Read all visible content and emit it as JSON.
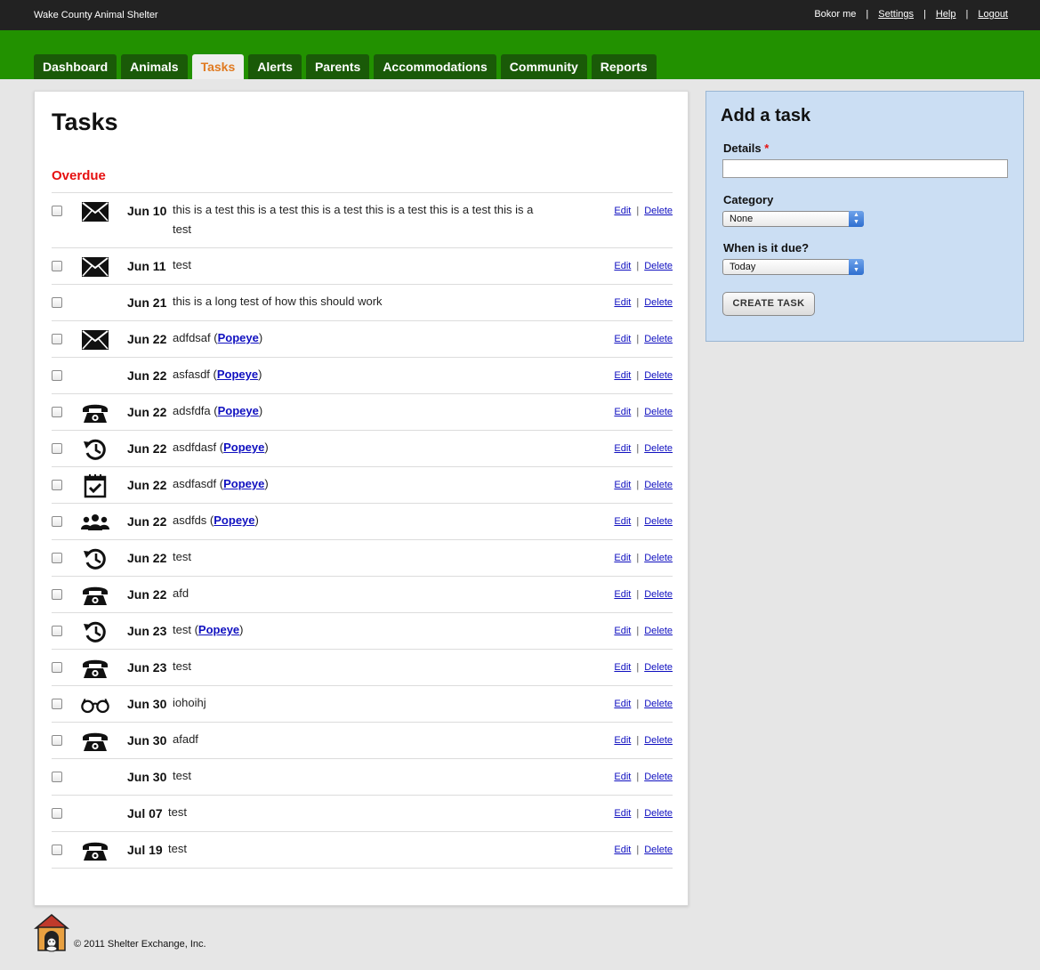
{
  "topbar": {
    "org": "Wake County Animal Shelter",
    "user": "Bokor me",
    "settings": "Settings",
    "help": "Help",
    "logout": "Logout",
    "separator": "|"
  },
  "nav": {
    "tabs": [
      {
        "label": "Dashboard",
        "active": false
      },
      {
        "label": "Animals",
        "active": false
      },
      {
        "label": "Tasks",
        "active": true
      },
      {
        "label": "Alerts",
        "active": false
      },
      {
        "label": "Parents",
        "active": false
      },
      {
        "label": "Accommodations",
        "active": false
      },
      {
        "label": "Community",
        "active": false
      },
      {
        "label": "Reports",
        "active": false
      }
    ]
  },
  "main": {
    "title": "Tasks",
    "section": "Overdue",
    "edit_label": "Edit",
    "delete_label": "Delete",
    "separator": "|",
    "tasks": [
      {
        "icon": "mail-icon",
        "date": "Jun 10",
        "desc": "this is a test this is a test this is a test this is a test this is a test this is a test",
        "link": ""
      },
      {
        "icon": "mail-icon",
        "date": "Jun 11",
        "desc": "test",
        "link": ""
      },
      {
        "icon": "",
        "date": "Jun 21",
        "desc": "this is a long test of how this should work",
        "link": ""
      },
      {
        "icon": "mail-icon",
        "date": "Jun 22",
        "desc": "adfdsaf",
        "link": "Popeye"
      },
      {
        "icon": "",
        "date": "Jun 22",
        "desc": "asfasdf",
        "link": "Popeye"
      },
      {
        "icon": "phone-icon",
        "date": "Jun 22",
        "desc": "adsfdfa",
        "link": "Popeye"
      },
      {
        "icon": "history-icon",
        "date": "Jun 22",
        "desc": "asdfdasf",
        "link": "Popeye"
      },
      {
        "icon": "calendar-check-icon",
        "date": "Jun 22",
        "desc": "asdfasdf",
        "link": "Popeye"
      },
      {
        "icon": "people-icon",
        "date": "Jun 22",
        "desc": "asdfds",
        "link": "Popeye"
      },
      {
        "icon": "history-icon",
        "date": "Jun 22",
        "desc": "test",
        "link": ""
      },
      {
        "icon": "phone-icon",
        "date": "Jun 22",
        "desc": "afd",
        "link": ""
      },
      {
        "icon": "history-icon",
        "date": "Jun 23",
        "desc": "test",
        "link": "Popeye"
      },
      {
        "icon": "phone-icon",
        "date": "Jun 23",
        "desc": "test",
        "link": ""
      },
      {
        "icon": "glasses-icon",
        "date": "Jun 30",
        "desc": "iohoihj",
        "link": ""
      },
      {
        "icon": "phone-icon",
        "date": "Jun 30",
        "desc": "afadf",
        "link": ""
      },
      {
        "icon": "",
        "date": "Jun 30",
        "desc": "test",
        "link": ""
      },
      {
        "icon": "",
        "date": "Jul 07",
        "desc": "test",
        "link": ""
      },
      {
        "icon": "phone-icon",
        "date": "Jul 19",
        "desc": "test",
        "link": ""
      }
    ]
  },
  "sidebar": {
    "title": "Add a task",
    "details_label": "Details",
    "required_mark": "*",
    "details_value": "",
    "category_label": "Category",
    "category_value": "None",
    "due_label": "When is it due?",
    "due_value": "Today",
    "create_button": "CREATE TASK"
  },
  "footer": {
    "copyright": "© 2011 Shelter Exchange, Inc."
  }
}
